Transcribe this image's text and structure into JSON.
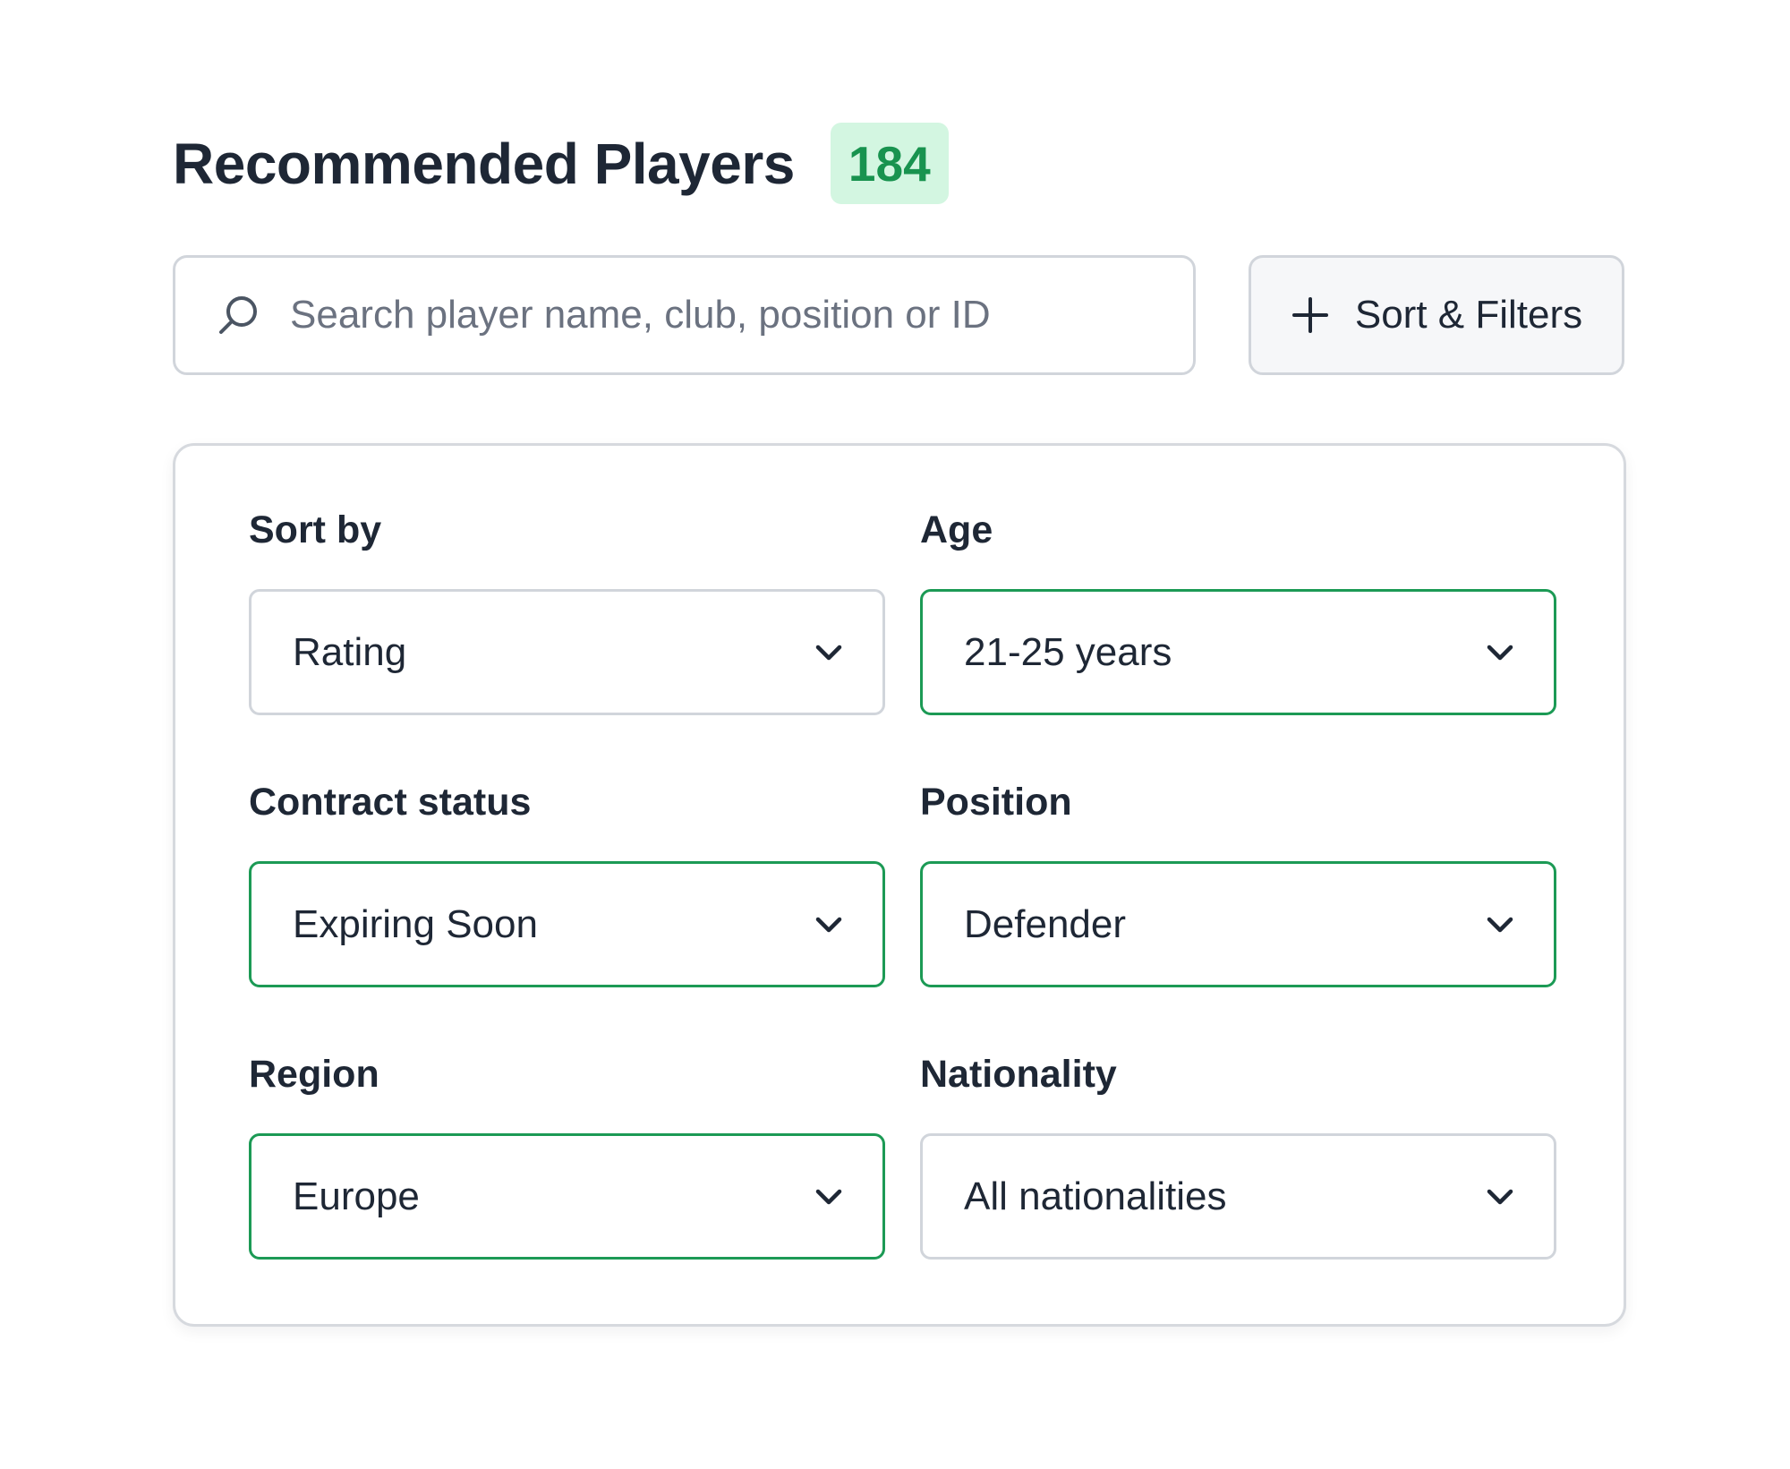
{
  "header": {
    "title": "Recommended Players",
    "count": "184"
  },
  "search": {
    "placeholder": "Search player name, club, position or ID",
    "value": "",
    "icon": "search-icon"
  },
  "filters_button": {
    "label": "Sort & Filters",
    "icon": "plus-icon"
  },
  "filters": [
    {
      "label": "Sort by",
      "value": "Rating",
      "active": false
    },
    {
      "label": "Age",
      "value": "21-25 years",
      "active": true
    },
    {
      "label": "Contract status",
      "value": "Expiring Soon",
      "active": true
    },
    {
      "label": "Position",
      "value": "Defender",
      "active": true
    },
    {
      "label": "Region",
      "value": "Europe",
      "active": true
    },
    {
      "label": "Nationality",
      "value": "All nationalities",
      "active": false
    }
  ],
  "colors": {
    "accent_green": "#1c9a55",
    "badge_background": "#d3f6e1",
    "badge_text": "#18934f",
    "text_primary": "#1e2735",
    "text_placeholder": "#6b7280",
    "border_default": "#d1d5db"
  }
}
